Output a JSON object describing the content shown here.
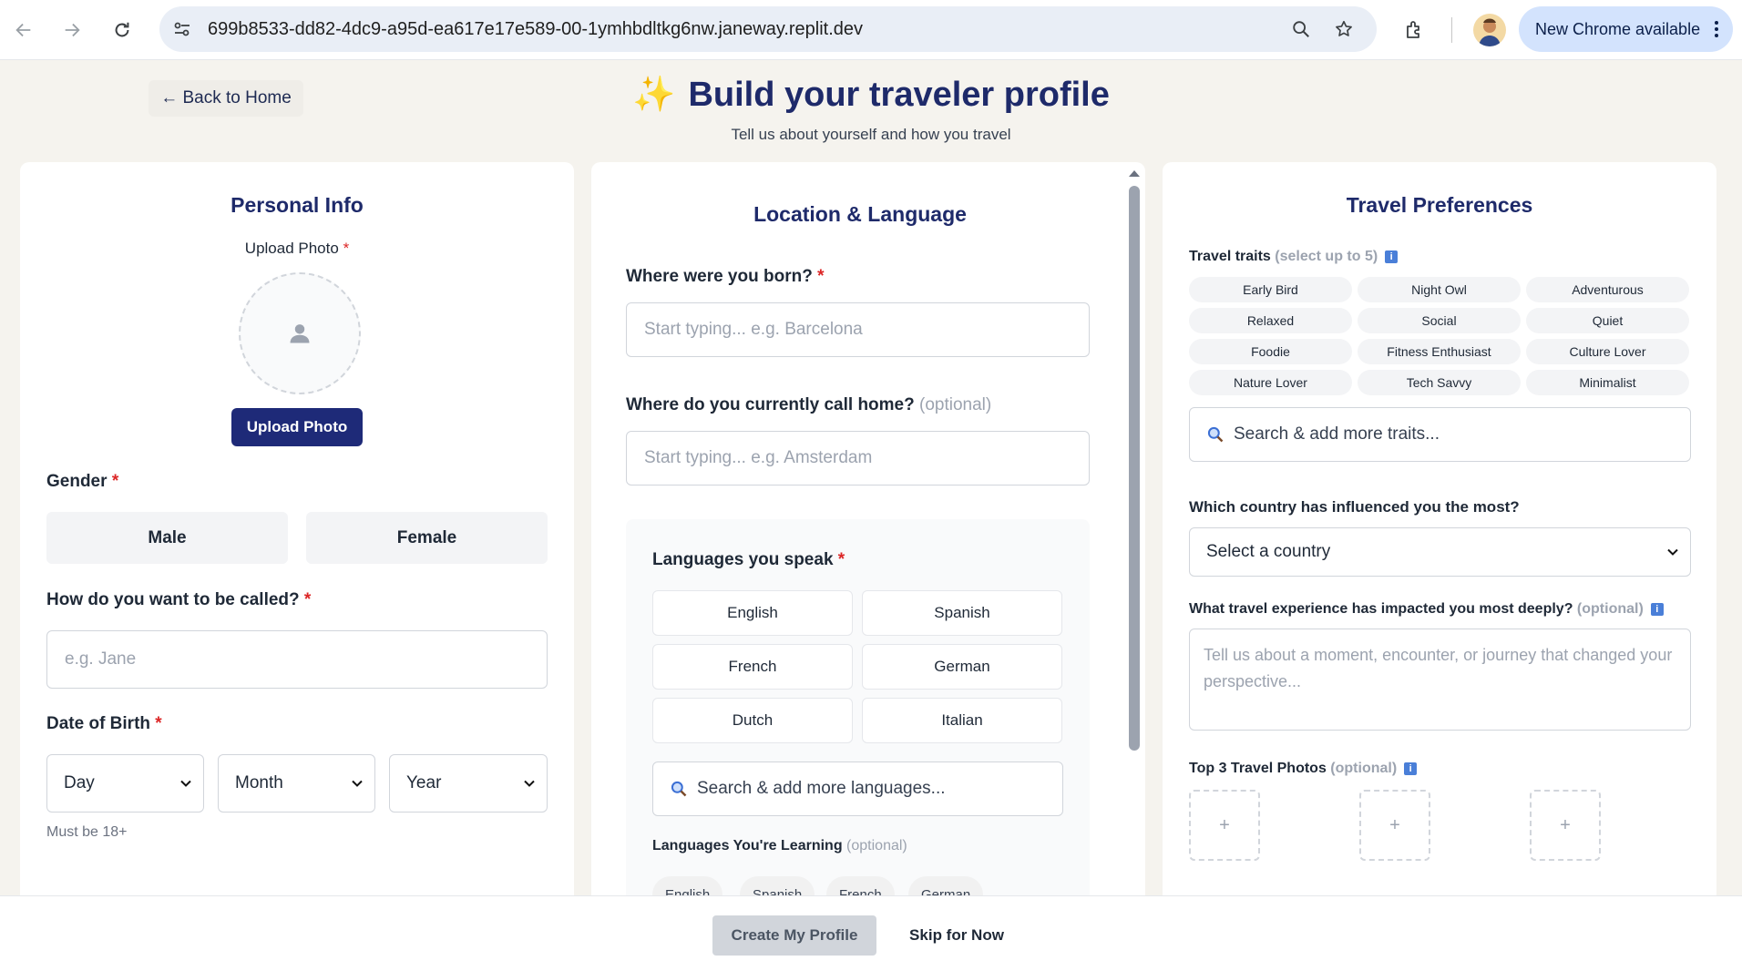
{
  "browser": {
    "url": "699b8533-dd82-4dc9-a95d-ea617e17e589-00-1ymhbdltkg6nw.janeway.replit.dev",
    "update_label": "New Chrome available"
  },
  "header": {
    "back_label": "← Back to Home",
    "title_icon": "✨",
    "title": "Build your traveler profile",
    "subtitle": "Tell us about yourself and how you travel"
  },
  "personal": {
    "title": "Personal Info",
    "upload_label": "Upload Photo",
    "upload_button": "Upload Photo",
    "gender_label": "Gender",
    "gender_options": [
      "Male",
      "Female"
    ],
    "name_label": "How do you want to be called?",
    "name_placeholder": "e.g. Jane",
    "dob_label": "Date of Birth",
    "dob_day": "Day",
    "dob_month": "Month",
    "dob_year": "Year",
    "dob_hint": "Must be 18+",
    "required_mark": "*"
  },
  "location": {
    "title": "Location & Language",
    "born_label": "Where were you born?",
    "born_placeholder": "Start typing... e.g. Barcelona",
    "home_label": "Where do you currently call home?",
    "home_optional": "(optional)",
    "home_placeholder": "Start typing... e.g. Amsterdam",
    "languages_label": "Languages you speak",
    "languages": [
      "English",
      "Spanish",
      "French",
      "German",
      "Dutch",
      "Italian"
    ],
    "language_search": "Search & add more languages...",
    "learning_label": "Languages You're Learning",
    "learning_optional": "(optional)",
    "learning_chips": [
      "English",
      "Spanish",
      "French",
      "German"
    ]
  },
  "travel": {
    "title": "Travel Preferences",
    "traits_label": "Travel traits",
    "traits_hint": "(select up to 5)",
    "traits": [
      "Early Bird",
      "Night Owl",
      "Adventurous",
      "Relaxed",
      "Social",
      "Quiet",
      "Foodie",
      "Fitness Enthusiast",
      "Culture Lover",
      "Nature Lover",
      "Tech Savvy",
      "Minimalist"
    ],
    "trait_search": "Search & add more traits...",
    "country_label": "Which country has influenced you the most?",
    "country_select": "Select a country",
    "experience_label": "What travel experience has impacted you most deeply?",
    "experience_optional": "(optional)",
    "experience_placeholder": "Tell us about a moment, encounter, or journey that changed your perspective...",
    "photos_label": "Top 3 Travel Photos",
    "photos_optional": "(optional)",
    "photo_plus": "+",
    "info_glyph": "i"
  },
  "footer": {
    "create_label": "Create My Profile",
    "skip_label": "Skip for Now"
  },
  "colors": {
    "primary": "#1e2a78",
    "title": "#1e2a6a",
    "required": "#dc2626",
    "page_bg": "#f5f3ee",
    "info": "#4a7fd8"
  }
}
